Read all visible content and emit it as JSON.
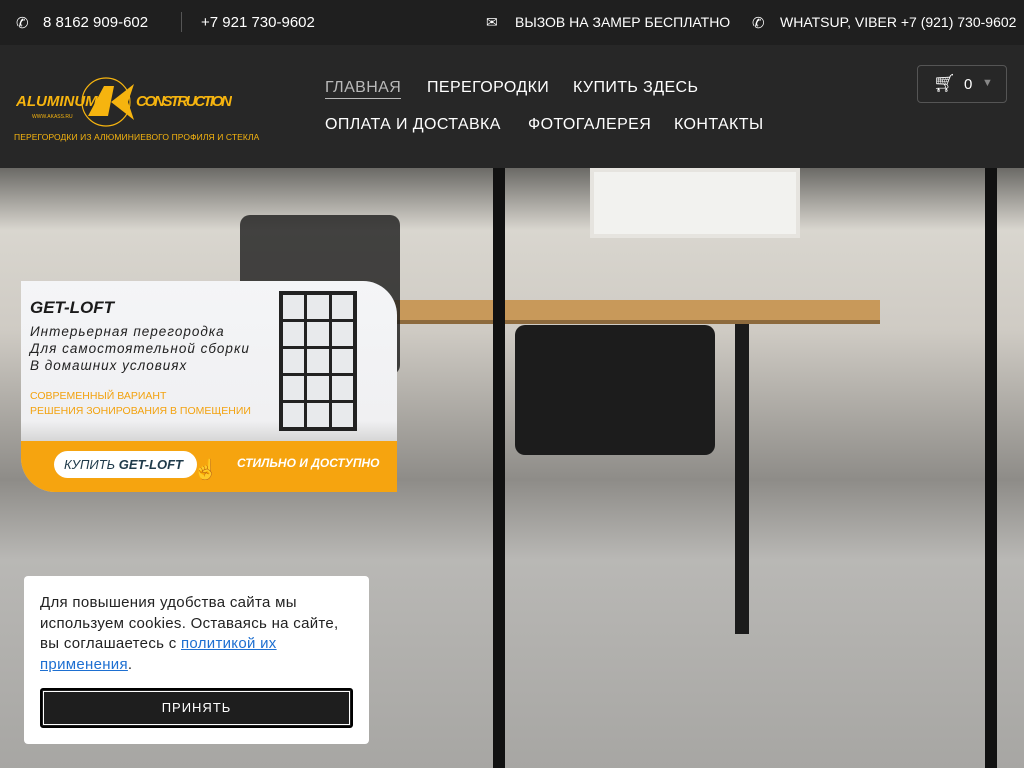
{
  "topbar": {
    "phone1": "8 8162 909-602",
    "phone2": "+7 921 730-9602",
    "measure": "ВЫЗОВ НА ЗАМЕР БЕСПЛАТНО",
    "messengers": "WHATSUP, VIBER +7 (921) 730-9602"
  },
  "logo": {
    "left": "ALUMINUM",
    "right": "CONSTRUCTION",
    "site": "WWW.AKASS.RU",
    "tagline": "ПЕРЕГОРОДКИ ИЗ АЛЮМИНИЕВОГО ПРОФИЛЯ И СТЕКЛА"
  },
  "nav": [
    "ГЛАВНАЯ",
    "ПЕРЕГОРОДКИ",
    "КУПИТЬ ЗДЕСЬ",
    "ОПЛАТА И ДОСТАВКА",
    "ФОТОГАЛЕРЕЯ",
    "КОНТАКТЫ"
  ],
  "cart": {
    "count": "0"
  },
  "banner": {
    "title": "GET-LOFT",
    "sub1": "Интерьерная перегородка",
    "sub2": "Для самостоятельной сборки",
    "sub3": "В домашних условиях",
    "offer1": "СОВРЕМЕННЫЙ ВАРИАНТ",
    "offer2": "РЕШЕНИЯ ЗОНИРОВАНИЯ В ПОМЕЩЕНИИ",
    "button_a": "КУПИТЬ ",
    "button_b": "GET-LOFT",
    "slogan": "СТИЛЬНО И ДОСТУПНО"
  },
  "cookie": {
    "text": "Для повышения удобства сайта мы используем cookies. Оставаясь на сайте, вы соглашаетесь с ",
    "link": "политикой их применения",
    "end": ".",
    "accept": "ПРИНЯТЬ"
  },
  "colors": {
    "accent": "#f6a40f",
    "link": "#1d6fd1"
  }
}
